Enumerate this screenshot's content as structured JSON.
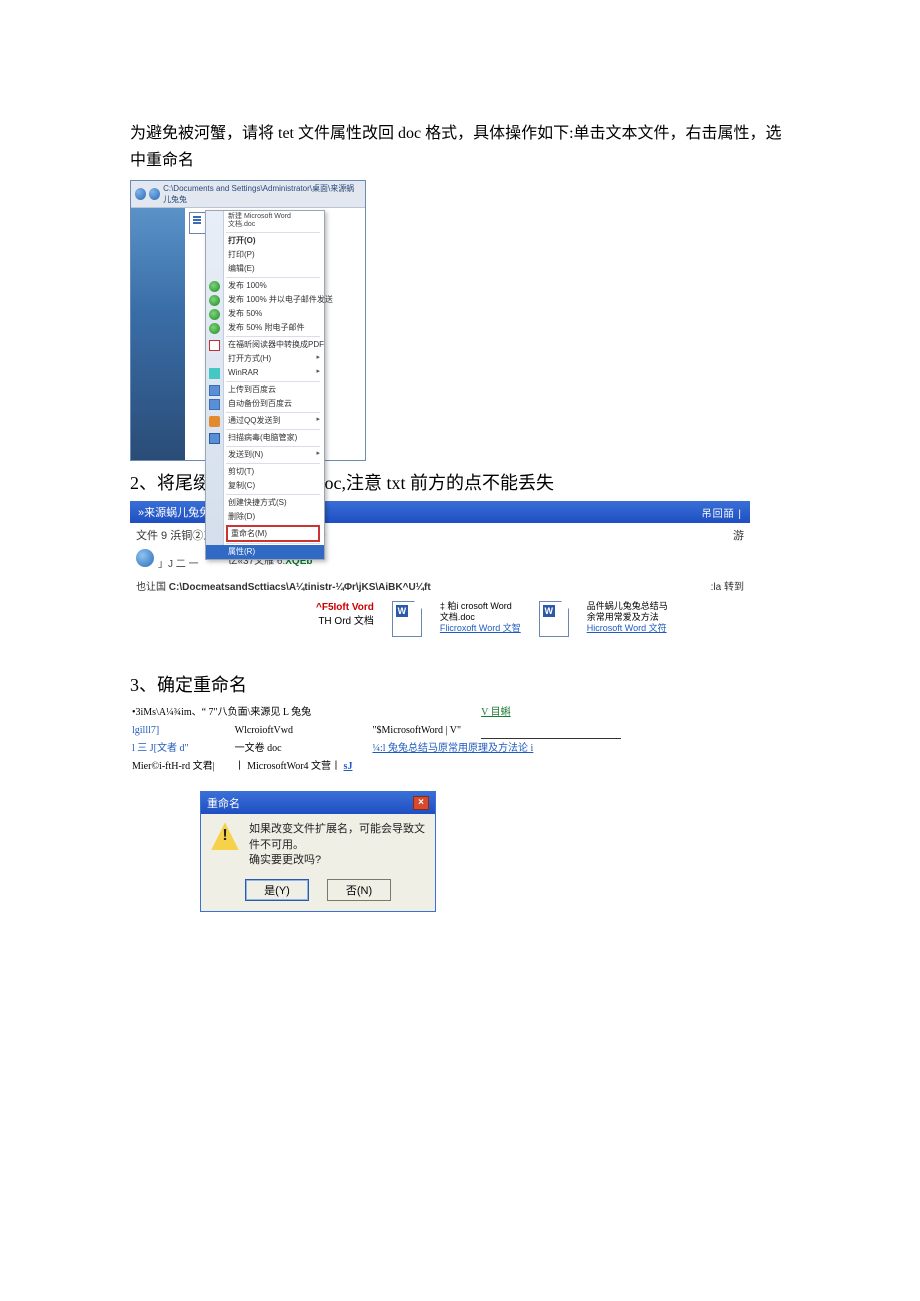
{
  "intro": "为避免被河蟹，请将 tet 文件属性改回 doc 格式，具体操作如下:单击文本文件，右击属性，选中重命名",
  "shot1": {
    "address_path": "C:\\Documents and Settings\\Administrator\\桌面\\来源蜗儿兔兔",
    "file_label_top": "新建 Microsoft Word",
    "file_label_bot": "文档.doc",
    "file_side_label": "文档",
    "menu": {
      "open": "打开(O)",
      "print": "打印(P)",
      "edit": "编辑(E)",
      "share100": "发布 100%",
      "share100mail": "发布 100% 并以电子邮件发送",
      "share50": "发布 50%",
      "share50att": "发布 50% 附电子邮件",
      "pdf": "在福昕阅读器中转换成PDF",
      "openwith": "打开方式(H)",
      "winrar": "WinRAR",
      "prevver": "上传到百度云",
      "autobak": "自动备份到百度云",
      "virus": "通过QQ发送到",
      "scan": "扫描病毒(电脑管家)",
      "sendto": "发送到(N)",
      "cut": "剪切(T)",
      "copy": "复制(C)",
      "shortcut": "创建快捷方式(S)",
      "delete": "删除(D)",
      "rename": "重命名(M)",
      "props": "属性(R)"
    }
  },
  "step2": "2、将尾缀属性 txt 改为 doc,注意 txt 前方的点不能丢失",
  "shot2": {
    "title_left": "»来源蜗儿兔兔",
    "title_right": "吊回皕 |",
    "menubar_left": "文件 9 浜铜②三 S(v)收藏⑤Tfi(l)帮助⑤",
    "menubar_right": "游",
    "toolbar_left": "」J 二 一",
    "toolbar_mid": "tZ«37文雁 6.",
    "toolbar_green": "XQEb",
    "addr_label": "也让国",
    "addr_path": "C:\\DocmeatsandScttiacs\\A¼tinistr-¼Φr\\jKS\\AiBK^U¼ft",
    "addr_go": ":la 转到",
    "col1_l1": "^F5Ioft Vord",
    "col1_l2": "TH Ord 文档",
    "file2_l1": "‡ 粕i crosoft Word",
    "file2_l2": "文档.doc",
    "file2_l3": "Flicroxoft Word 文智",
    "file3_l1": "品件蜗儿兔兔总结马",
    "file3_l2": "余常用常爱及方法",
    "file3_l3": "Hicrosoft Word 文符"
  },
  "step3": "3、确定重命名",
  "sec3": {
    "r1c1": "•3iMs\\A¼¾im、“ 7\"八负面\\来源见 L 兔兔",
    "r1c4": "V 目蝌",
    "r2c1": "lgilll7]",
    "r2c2": "WlcroioftVwd",
    "r2c3": "\"$MicrosoftWord | V\"",
    "r3c1": "l 三 J[文者 d\"",
    "r3c2": "一文卷 doc",
    "r3c3": "¼:l 兔兔总结马原常用原理及方法论 i",
    "r4c1": "Mier©i-ftH-rd 文君|",
    "r4c2": "丨 MicrosoftWor4 文营丨",
    "r4c3": "sJ"
  },
  "dialog": {
    "title": "重命名",
    "line1": "如果改变文件扩展名，可能会导致文件不可用。",
    "line2": "确实要更改吗?",
    "yes": "是(Y)",
    "no": "否(N)"
  }
}
